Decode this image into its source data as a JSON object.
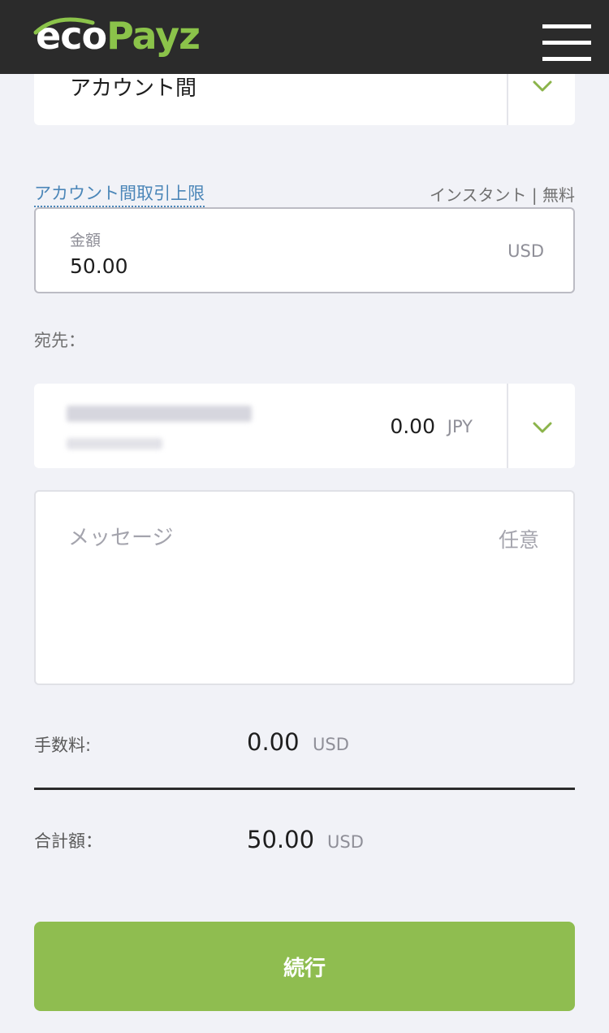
{
  "header": {
    "logo_part1": "eco",
    "logo_part2": "Payz",
    "brand_color": "#8bc34a",
    "menu_icon": "hamburger-icon"
  },
  "transfer_type": {
    "selected": "アカウント間",
    "icon": "chevron-down-icon"
  },
  "limits": {
    "link_label": "アカウント間取引上限",
    "info": "インスタント | 無料"
  },
  "amount": {
    "label": "金額",
    "value": "50.00",
    "currency": "USD"
  },
  "recipient": {
    "label": "宛先：",
    "balance": "0.00",
    "currency": "JPY",
    "icon": "chevron-down-icon"
  },
  "message": {
    "placeholder": "メッセージ",
    "optional_label": "任意"
  },
  "fee": {
    "label": "手数料:",
    "value": "0.00",
    "currency": "USD"
  },
  "total": {
    "label": "合計額：",
    "value": "50.00",
    "currency": "USD"
  },
  "actions": {
    "continue_label": "続行",
    "button_color": "#8fbd50"
  }
}
